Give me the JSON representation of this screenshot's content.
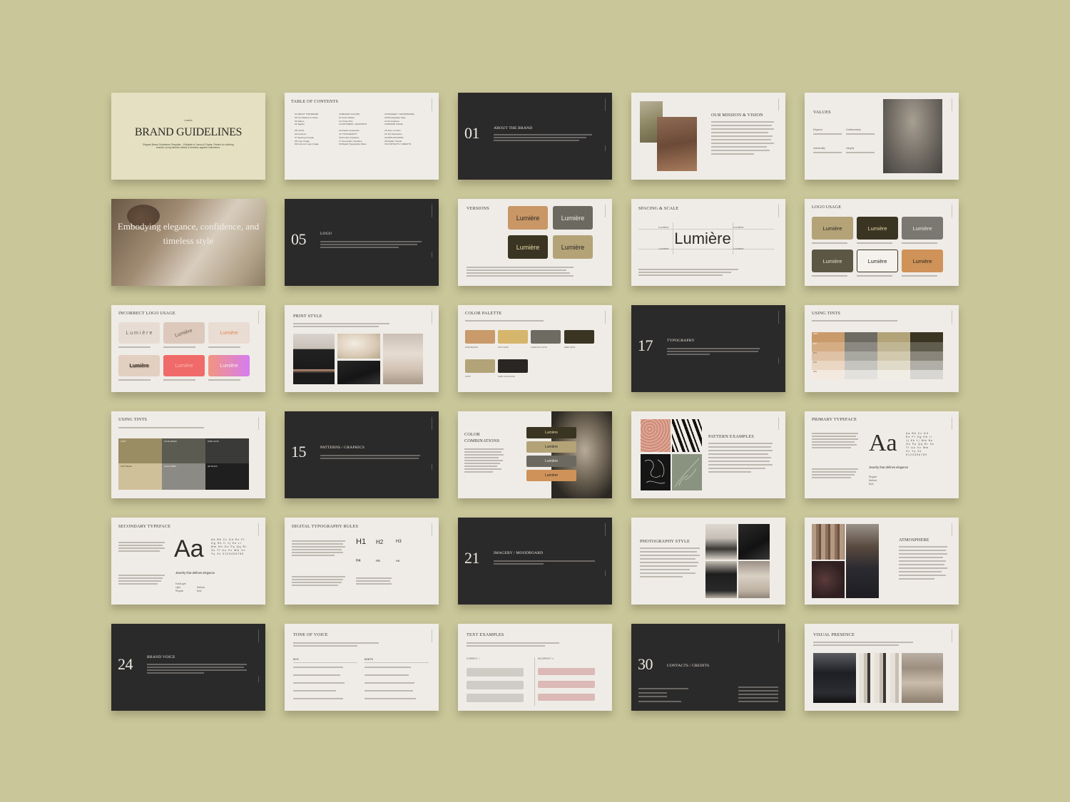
{
  "cover": {
    "brand": "Lumière",
    "title": "BRAND GUIDELINES",
    "subtitle": "Elegant Brand Guidelines Template – Editable in Canva & Figma. Perfect for clothing brands, luxury fashion labels & timeless apparel collections."
  },
  "toc": {
    "title": "TABLE OF CONTENTS",
    "columns": [
      [
        "01 ABOUT THE BRAND",
        "02 Our Mission & Vision",
        "03 Values",
        "04 Tagline",
        "05 LOGO",
        "06 Versions",
        "07 Spacing & Scale",
        "08 Logo Usage",
        "09 Incorrect Logo Usage"
      ],
      [
        "10 BRAND COLORS",
        "11 Color Palette",
        "12 Using Tints",
        "13 PATTERNS / GRAPHICS",
        "14 Pattern Examples",
        "15 TYPOGRAPHY",
        "16 Primary Typeface",
        "17 Secondary Typeface",
        "18 Digital Typography Rules"
      ],
      [
        "19 IMAGERY / MOODBOARD",
        "20 Photography Style",
        "21 Atmosphere",
        "22 BRAND VOICE",
        "23 Tone of Voice",
        "24 Text Examples",
        "25 APPLICATIONS",
        "26 Digital / Social",
        "30 CONTACTS / CREDITS"
      ]
    ]
  },
  "about": {
    "number": "01",
    "title": "ABOUT THE BRAND"
  },
  "mission": {
    "title": "OUR MISSION & VISION"
  },
  "values": {
    "title": "VALUES",
    "items": [
      "Elegance",
      "Craftsmanship",
      "Individuality",
      "Integrity"
    ]
  },
  "hero": {
    "quote": "Embodying elegance, confidence, and timeless style"
  },
  "logo_section": {
    "number": "05",
    "title": "LOGO"
  },
  "versions": {
    "title": "VERSIONS",
    "logo_word": "Lumière"
  },
  "spacing": {
    "title": "SPACING & SCALE",
    "logo_word": "Lumière",
    "small_word": "Lumiere"
  },
  "logo_usage": {
    "title": "LOGO USAGE",
    "logo_word": "Lumière"
  },
  "incorrect": {
    "title": "INCORRECT LOGO USAGE",
    "spaced": "L u m i è r e",
    "logo_word": "Lumière"
  },
  "print_style": {
    "title": "PRINT STYLE"
  },
  "palette": {
    "title": "COLOR PALETTE",
    "names": [
      "SAND BROWN",
      "SOFT SAND",
      "CHARCOAL OLIVE",
      "DEEP MOSS",
      "IVORY",
      "DARK CHOCOLATE"
    ]
  },
  "typography": {
    "number": "17",
    "title": "TYPOGRAPHY"
  },
  "using_tints": {
    "title": "USING TINTS",
    "percents": [
      "100%",
      "80%",
      "60%",
      "40%",
      "20%"
    ]
  },
  "using_tints2": {
    "title": "USING TINTS",
    "names": [
      "IVORY",
      "OLIVE GREEN",
      "DARK OLIVE",
      "SOFT BEIGE",
      "SAGE GREEN",
      "JET BLACK"
    ]
  },
  "patterns": {
    "number": "15",
    "title": "PATTERNS / GRAPHICS"
  },
  "combos": {
    "title": "COLOR COMBINATIONS",
    "logo_word": "Lumière"
  },
  "pattern_examples": {
    "title": "PATTERN EXAMPLES"
  },
  "primary_type": {
    "title": "PRIMARY TYPEFACE",
    "sample": "Aa",
    "tagline": "Jewelry that defines elegance",
    "weights": [
      "Regular",
      "Medium",
      "Bold"
    ]
  },
  "secondary_type": {
    "title": "SECONDARY TYPEFACE",
    "sample": "Aa",
    "tagline": "Jewelry that defines elegance",
    "weights": [
      "ExtraLight",
      "Light",
      "Regular",
      "Medium",
      "Bold"
    ]
  },
  "digital_rules": {
    "title": "DIGITAL TYPOGRAPHY RULES",
    "heads": [
      "H1",
      "H2",
      "H3",
      "H4",
      "H5",
      "H6"
    ]
  },
  "imagery": {
    "number": "21",
    "title": "IMAGERY / MOODBOARD"
  },
  "photo_style": {
    "title": "PHOTOGRAPHY STYLE"
  },
  "atmosphere": {
    "title": "ATMOSPHERE"
  },
  "brand_voice": {
    "number": "24",
    "title": "BRAND VOICE"
  },
  "tone": {
    "title": "TONE OF VOICE",
    "dos": "DO'S",
    "donts": "DON'TS"
  },
  "text_examples": {
    "title": "TEXT EXAMPLES",
    "correct": "CORRECT",
    "incorrect": "INCORRECT"
  },
  "contacts": {
    "number": "30",
    "title": "CONTACTS / CREDITS"
  },
  "visual": {
    "title": "VISUAL PRESENCE"
  },
  "colors": {
    "background": "#c9c69a",
    "slide_light": "#efece7",
    "slide_dark": "#2b2a2a",
    "cover": "#e5e0c2",
    "sand": "#c99a6a",
    "soft_sand": "#d6b56c",
    "olive": "#6e6c62",
    "moss": "#3a3422",
    "khaki": "#b2a478",
    "chocolate": "#2a2624"
  }
}
